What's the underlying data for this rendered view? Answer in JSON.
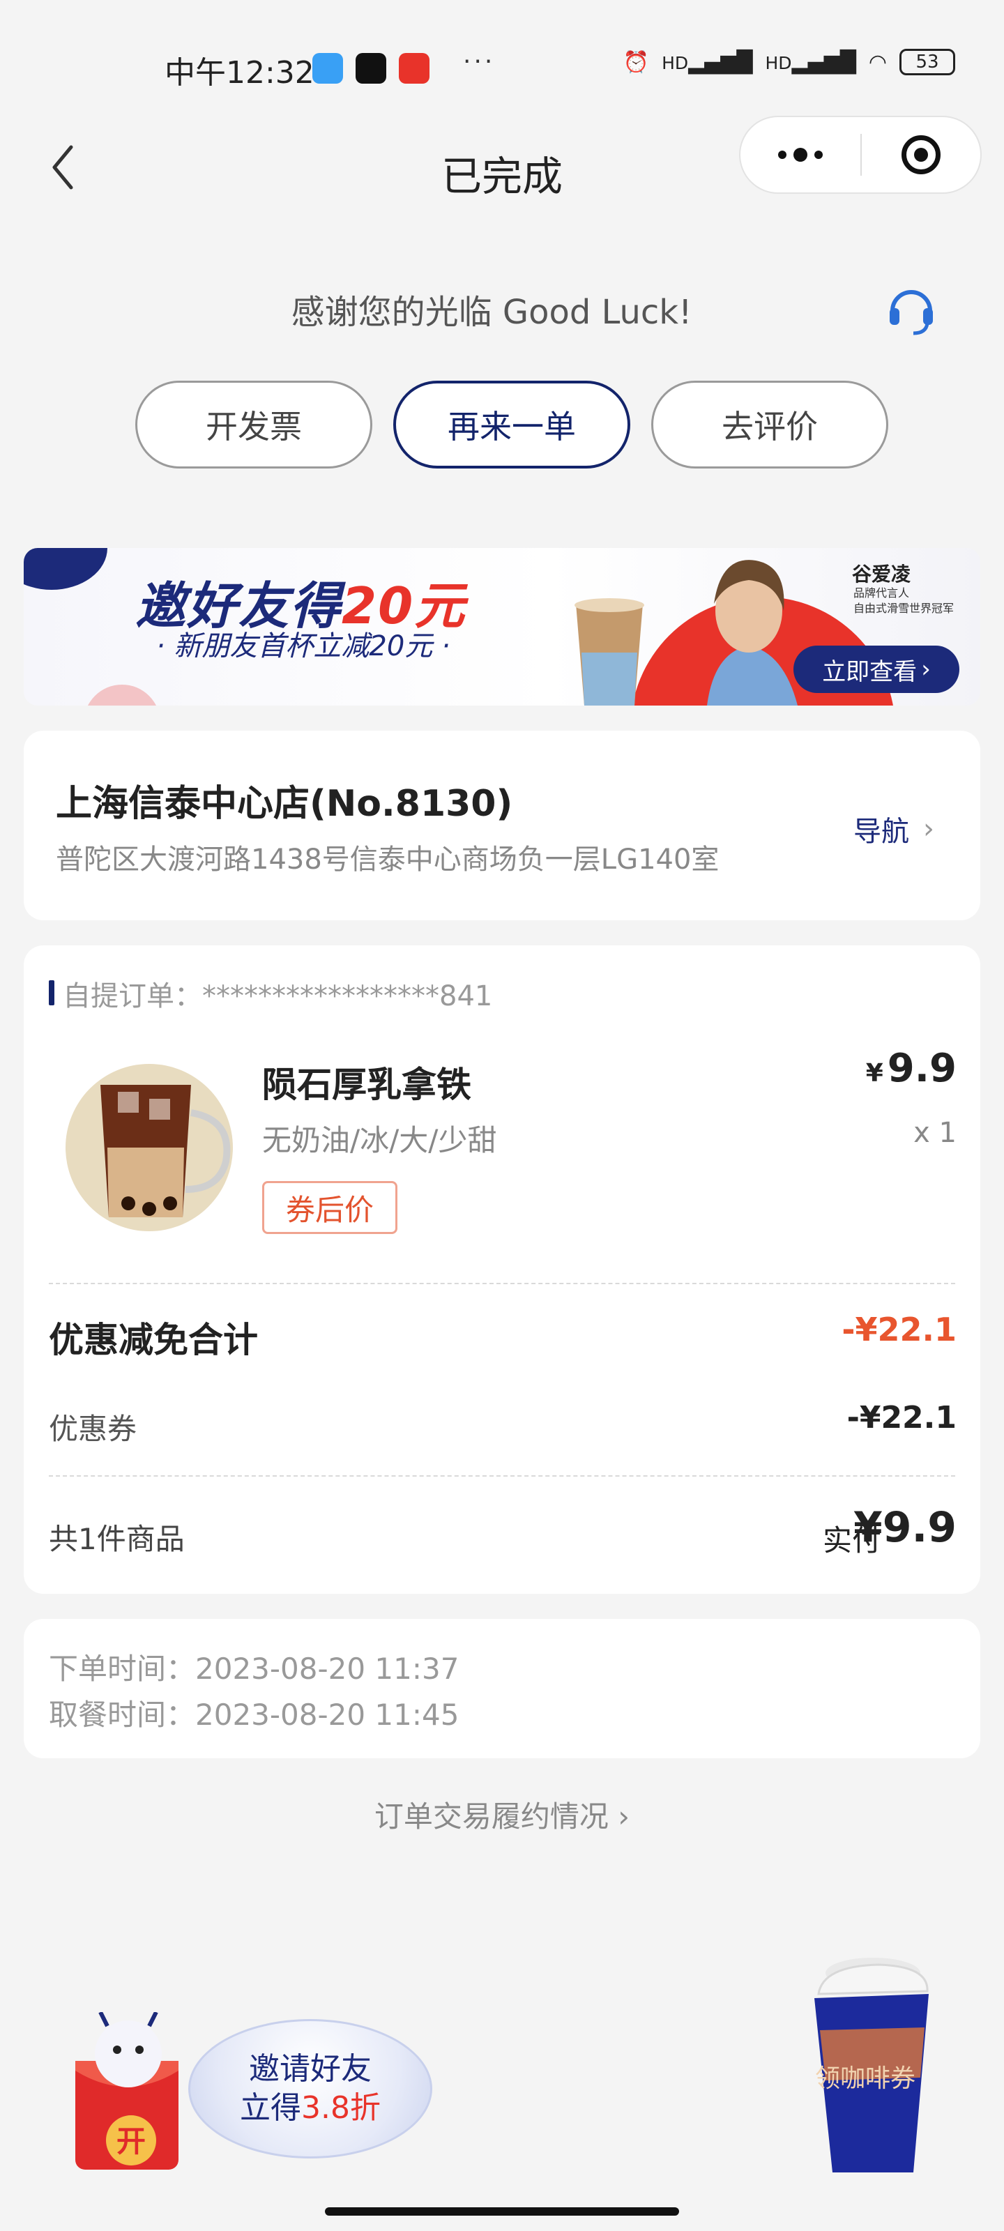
{
  "status_bar": {
    "time": "中午12:32",
    "dots": "···",
    "network_1": "HD",
    "network_2": "HD",
    "battery": "53"
  },
  "nav": {
    "title": "已完成"
  },
  "thanks": {
    "text": "感谢您的光临 Good Luck!"
  },
  "actions": {
    "invoice": "开发票",
    "reorder": "再来一单",
    "review": "去评价"
  },
  "banner": {
    "title_prefix": "邀好友得",
    "title_amount": "20元",
    "subtitle": "· 新朋友首杯立减20元 ·",
    "brand_name": "谷爱凌",
    "brand_desc_1": "品牌代言人",
    "brand_desc_2": "自由式滑雪世界冠军",
    "button": "立即查看"
  },
  "store": {
    "name": "上海信泰中心店(No.8130)",
    "address": "普陀区大渡河路1438号信泰中心商场负一层LG140室",
    "nav_label": "导航"
  },
  "order": {
    "type_label": "自提订单：",
    "number": "*****************841",
    "product": {
      "name": "陨石厚乳拿铁",
      "spec": "无奶油/冰/大/少甜",
      "tag": "券后价",
      "price_symbol": "¥",
      "price": "9.9",
      "qty": "x 1"
    },
    "discount_label": "优惠减免合计",
    "discount_total": "-¥22.1",
    "coupon_label": "优惠券",
    "coupon_value": "-¥22.1",
    "count_label": "共1件商品",
    "paid_label": "实付",
    "paid_value": "¥9.9"
  },
  "times": {
    "order_time": "下单时间：2023-08-20 11:37",
    "pickup_time": "取餐时间：2023-08-20 11:45"
  },
  "fulfillment": {
    "label": "订单交易履约情况"
  },
  "float_invite": {
    "line1": "邀请好友",
    "line2_prefix": "立得",
    "line2_highlight": "3.8折",
    "packet_char": "开"
  },
  "float_coupon": {
    "label": "领咖啡券"
  },
  "colors": {
    "brand_blue": "#13246b",
    "accent_red": "#e8332a",
    "discount_orange": "#e8552e",
    "background": "#f4f4f4"
  }
}
